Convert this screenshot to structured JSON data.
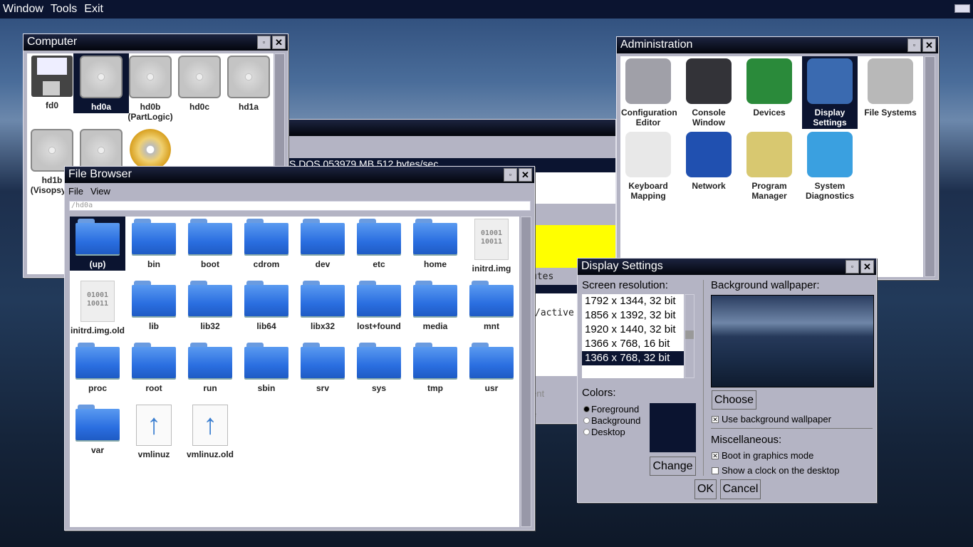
{
  "menubar": {
    "items": [
      "Window",
      "Tools",
      "Exit"
    ]
  },
  "background_window": {
    "header_text": "S DOS 053979 MB 512 bytes/sec",
    "attr_text": "utes",
    "list_text": "/active",
    "row1": "ent",
    "row2": "e",
    "highlight_color": "#ffff00"
  },
  "computer": {
    "title": "Computer",
    "items": [
      {
        "label": "fd0",
        "icon": "floppy-icon"
      },
      {
        "label": "hd0a",
        "icon": "hard-drive-icon",
        "selected": true
      },
      {
        "label": "hd0b (PartLogic)",
        "icon": "hard-drive-icon"
      },
      {
        "label": "hd0c",
        "icon": "hard-drive-icon"
      },
      {
        "label": "hd1a",
        "icon": "hard-drive-icon"
      },
      {
        "label": "hd1b (Visopsys)",
        "icon": "hard-drive-icon"
      },
      {
        "label": "",
        "icon": "hard-drive-icon"
      },
      {
        "label": "",
        "icon": "cd-icon"
      }
    ]
  },
  "file_browser": {
    "title": "File Browser",
    "menu": [
      "File",
      "View"
    ],
    "path": "/hd0a",
    "items": [
      {
        "label": "(up)",
        "icon": "folder-icon",
        "selected": true
      },
      {
        "label": "bin",
        "icon": "folder-icon"
      },
      {
        "label": "boot",
        "icon": "folder-icon"
      },
      {
        "label": "cdrom",
        "icon": "folder-icon"
      },
      {
        "label": "dev",
        "icon": "folder-icon"
      },
      {
        "label": "etc",
        "icon": "folder-icon"
      },
      {
        "label": "home",
        "icon": "folder-icon"
      },
      {
        "label": "initrd.img",
        "icon": "binary-file-icon"
      },
      {
        "label": "initrd.img.old",
        "icon": "binary-file-icon"
      },
      {
        "label": "lib",
        "icon": "folder-icon"
      },
      {
        "label": "lib32",
        "icon": "folder-icon"
      },
      {
        "label": "lib64",
        "icon": "folder-icon"
      },
      {
        "label": "libx32",
        "icon": "folder-icon"
      },
      {
        "label": "lost+found",
        "icon": "folder-icon"
      },
      {
        "label": "media",
        "icon": "folder-icon"
      },
      {
        "label": "mnt",
        "icon": "folder-icon"
      },
      {
        "label": "proc",
        "icon": "folder-icon"
      },
      {
        "label": "root",
        "icon": "folder-icon"
      },
      {
        "label": "run",
        "icon": "folder-icon"
      },
      {
        "label": "sbin",
        "icon": "folder-icon"
      },
      {
        "label": "srv",
        "icon": "folder-icon"
      },
      {
        "label": "sys",
        "icon": "folder-icon"
      },
      {
        "label": "tmp",
        "icon": "folder-icon"
      },
      {
        "label": "usr",
        "icon": "folder-icon"
      },
      {
        "label": "var",
        "icon": "folder-icon"
      },
      {
        "label": "vmlinuz",
        "icon": "executable-file-icon"
      },
      {
        "label": "vmlinuz.old",
        "icon": "executable-file-icon"
      }
    ]
  },
  "administration": {
    "title": "Administration",
    "items": [
      {
        "label": "Configuration Editor",
        "icon": "gear-icon",
        "color": "#a0a0a8"
      },
      {
        "label": "Console Window",
        "icon": "console-icon",
        "color": "#333338"
      },
      {
        "label": "Devices",
        "icon": "circuit-board-icon",
        "color": "#2a8a3a"
      },
      {
        "label": "Display Settings",
        "icon": "display-settings-icon",
        "color": "#3a6ab0",
        "selected": true
      },
      {
        "label": "File Systems",
        "icon": "database-icon",
        "color": "#b8b8b8"
      },
      {
        "label": "Keyboard Mapping",
        "icon": "keyboard-key-icon",
        "color": "#e8e8e8"
      },
      {
        "label": "Network",
        "icon": "globe-icon",
        "color": "#2050b0"
      },
      {
        "label": "Program Manager",
        "icon": "monitor-graph-icon",
        "color": "#d8c870"
      },
      {
        "label": "System Diagnostics",
        "icon": "diagnostics-icon",
        "color": "#3aa0e0"
      }
    ]
  },
  "display_settings": {
    "title": "Display Settings",
    "resolution_label": "Screen resolution:",
    "resolutions": [
      "1792 x 1344, 32 bit",
      "1856 x 1392, 32 bit",
      "1920 x 1440, 32 bit",
      "1366 x 768, 16 bit",
      "1366 x 768, 32 bit"
    ],
    "selected_resolution": "1366 x 768, 32 bit",
    "colors_label": "Colors:",
    "color_options": [
      "Foreground",
      "Background",
      "Desktop"
    ],
    "selected_color_option": "Foreground",
    "swatch_color": "#0b1430",
    "change_label": "Change",
    "wallpaper_label": "Background wallpaper:",
    "choose_label": "Choose",
    "use_wallpaper_label": "Use background wallpaper",
    "use_wallpaper": true,
    "misc_label": "Miscellaneous:",
    "boot_graphics_label": "Boot in graphics mode",
    "boot_graphics": true,
    "clock_label": "Show a clock on the desktop",
    "clock": false,
    "ok_label": "OK",
    "cancel_label": "Cancel"
  }
}
